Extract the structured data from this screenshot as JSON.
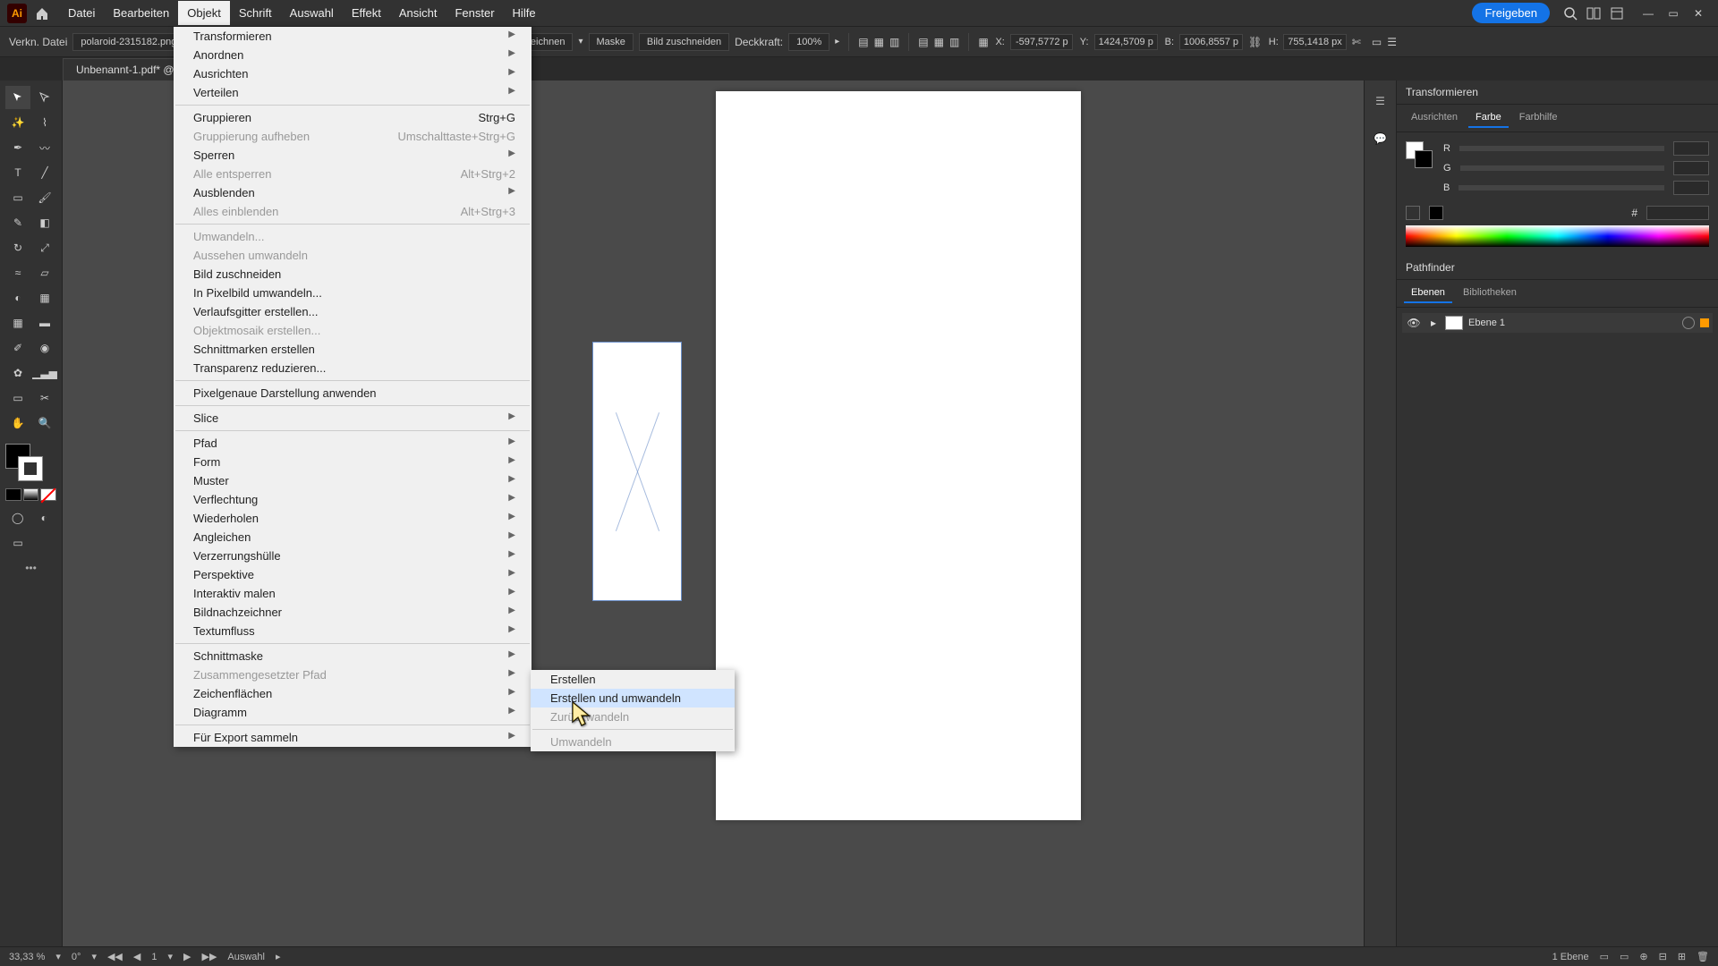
{
  "menubar": {
    "items": [
      "Datei",
      "Bearbeiten",
      "Objekt",
      "Schrift",
      "Auswahl",
      "Effekt",
      "Ansicht",
      "Fenster",
      "Hilfe"
    ],
    "share": "Freigeben"
  },
  "controlbar": {
    "linked_file": "Verkn. Datei",
    "filename": "polaroid-2315182.png",
    "btn1": "zeichnen",
    "mask": "Maske",
    "crop": "Bild zuschneiden",
    "opacity_label": "Deckkraft:",
    "opacity_val": "100%",
    "x": "-597,5772 p",
    "y": "1424,5709 p",
    "w": "1006,8557 p",
    "h": "755,1418 px"
  },
  "doctab": "Unbenannt-1.pdf* @",
  "object_menu": {
    "transformieren": "Transformieren",
    "anordnen": "Anordnen",
    "ausrichten": "Ausrichten",
    "verteilen": "Verteilen",
    "gruppieren": "Gruppieren",
    "gruppieren_sc": "Strg+G",
    "gruppierung_aufheben": "Gruppierung aufheben",
    "gruppierung_aufheben_sc": "Umschalttaste+Strg+G",
    "sperren": "Sperren",
    "alle_entsperren": "Alle entsperren",
    "alle_entsperren_sc": "Alt+Strg+2",
    "ausblenden": "Ausblenden",
    "alles_einblenden": "Alles einblenden",
    "alles_einblenden_sc": "Alt+Strg+3",
    "umwandeln": "Umwandeln...",
    "aussehen_umwandeln": "Aussehen umwandeln",
    "bild_zuschneiden": "Bild zuschneiden",
    "in_pixelbild": "In Pixelbild umwandeln...",
    "verlaufsgitter": "Verlaufsgitter erstellen...",
    "objektmosaik": "Objektmosaik erstellen...",
    "schnittmarken": "Schnittmarken erstellen",
    "transparenz": "Transparenz reduzieren...",
    "pixelgenau": "Pixelgenaue Darstellung anwenden",
    "slice": "Slice",
    "pfad": "Pfad",
    "form": "Form",
    "muster": "Muster",
    "verflechtung": "Verflechtung",
    "wiederholen": "Wiederholen",
    "angleichen": "Angleichen",
    "verzerrungshuelle": "Verzerrungshülle",
    "perspektive": "Perspektive",
    "interaktiv_malen": "Interaktiv malen",
    "bildnachzeichner": "Bildnachzeichner",
    "textumfluss": "Textumfluss",
    "schnittmaske": "Schnittmaske",
    "zusammengesetzter_pfad": "Zusammengesetzter Pfad",
    "zeichenflaechen": "Zeichenflächen",
    "diagramm": "Diagramm",
    "fuer_export": "Für Export sammeln"
  },
  "submenu": {
    "erstellen": "Erstellen",
    "erstellen_umwandeln": "Erstellen und umwandeln",
    "zurueck": "Zurückwandeln",
    "umwandeln": "Umwandeln"
  },
  "right": {
    "transformieren": "Transformieren",
    "tabs": [
      "Ausrichten",
      "Farbe",
      "Farbhilfe"
    ],
    "r": "R",
    "g": "G",
    "b": "B",
    "hex": "#",
    "pathfinder": "Pathfinder",
    "layer_tabs": [
      "Ebenen",
      "Bibliotheken"
    ],
    "layer1": "Ebene 1"
  },
  "status": {
    "zoom": "33,33 %",
    "page": "1",
    "tool": "Auswahl",
    "layer_count": "1 Ebene",
    "rot": "0°"
  }
}
